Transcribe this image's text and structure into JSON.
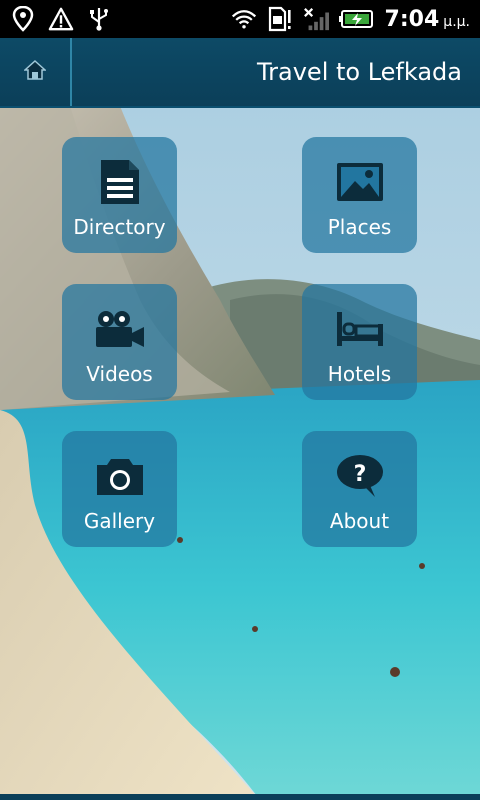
{
  "status_bar": {
    "icons": [
      "location-pin-icon",
      "warning-icon",
      "usb-icon",
      "wifi-icon",
      "sim-alert-icon",
      "signal-off-icon",
      "battery-charging-icon"
    ],
    "time": "7:04",
    "time_suffix": "μ.μ."
  },
  "header": {
    "home_icon": "home-icon",
    "title": "Travel to Lefkada"
  },
  "menu": [
    {
      "label": "Directory",
      "icon": "document-icon"
    },
    {
      "label": "Places",
      "icon": "picture-icon"
    },
    {
      "label": "Videos",
      "icon": "video-camera-icon"
    },
    {
      "label": "Hotels",
      "icon": "bed-icon"
    },
    {
      "label": "Gallery",
      "icon": "camera-icon"
    },
    {
      "label": "About",
      "icon": "question-bubble-icon"
    }
  ],
  "colors": {
    "header": "#0d4a66",
    "tile": "#2276a0",
    "sea": "#29b3c9",
    "sand": "#e9dcbf"
  }
}
